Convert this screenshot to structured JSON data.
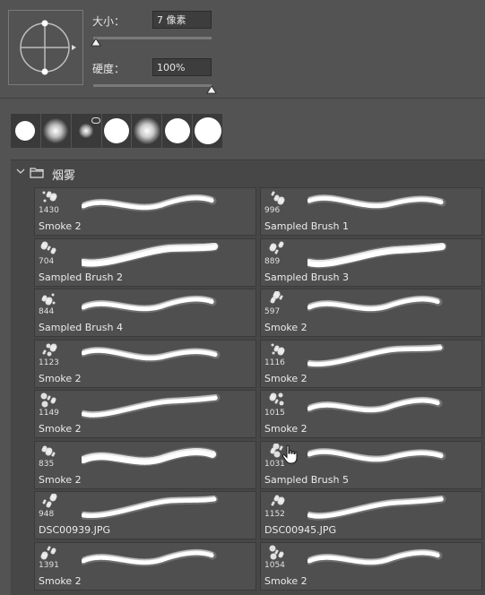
{
  "brush_settings": {
    "size_label": "大小：",
    "size_value": "7 像素",
    "size_slider_fraction": 0.02,
    "hardness_label": "硬度：",
    "hardness_value": "100%",
    "hardness_slider_fraction": 1.0
  },
  "tips": [
    {
      "icon": "hard-round-tip"
    },
    {
      "icon": "soft-round-tip"
    },
    {
      "icon": "airbrush-soft-tip"
    },
    {
      "icon": "hard-round-large-tip"
    },
    {
      "icon": "soft-round-large-tip"
    },
    {
      "icon": "hard-round-tip"
    },
    {
      "icon": "hard-round-tip"
    }
  ],
  "group": {
    "name": "烟雾",
    "expanded": true
  },
  "brushes": [
    {
      "size": "1430",
      "name": "Smoke 2"
    },
    {
      "size": "996",
      "name": "Sampled Brush 1"
    },
    {
      "size": "704",
      "name": "Sampled Brush 2"
    },
    {
      "size": "889",
      "name": "Sampled Brush 3"
    },
    {
      "size": "844",
      "name": "Sampled Brush 4"
    },
    {
      "size": "597",
      "name": "Smoke 2"
    },
    {
      "size": "1123",
      "name": "Smoke 2"
    },
    {
      "size": "1116",
      "name": "Smoke 2"
    },
    {
      "size": "1149",
      "name": "Smoke 2"
    },
    {
      "size": "1015",
      "name": "Smoke 2"
    },
    {
      "size": "835",
      "name": "Smoke 2"
    },
    {
      "size": "1031",
      "name": "Sampled Brush 5"
    },
    {
      "size": "948",
      "name": "DSC00939.JPG"
    },
    {
      "size": "1152",
      "name": "DSC00945.JPG"
    },
    {
      "size": "1391",
      "name": "Smoke 2"
    },
    {
      "size": "1054",
      "name": "Smoke 2"
    }
  ]
}
